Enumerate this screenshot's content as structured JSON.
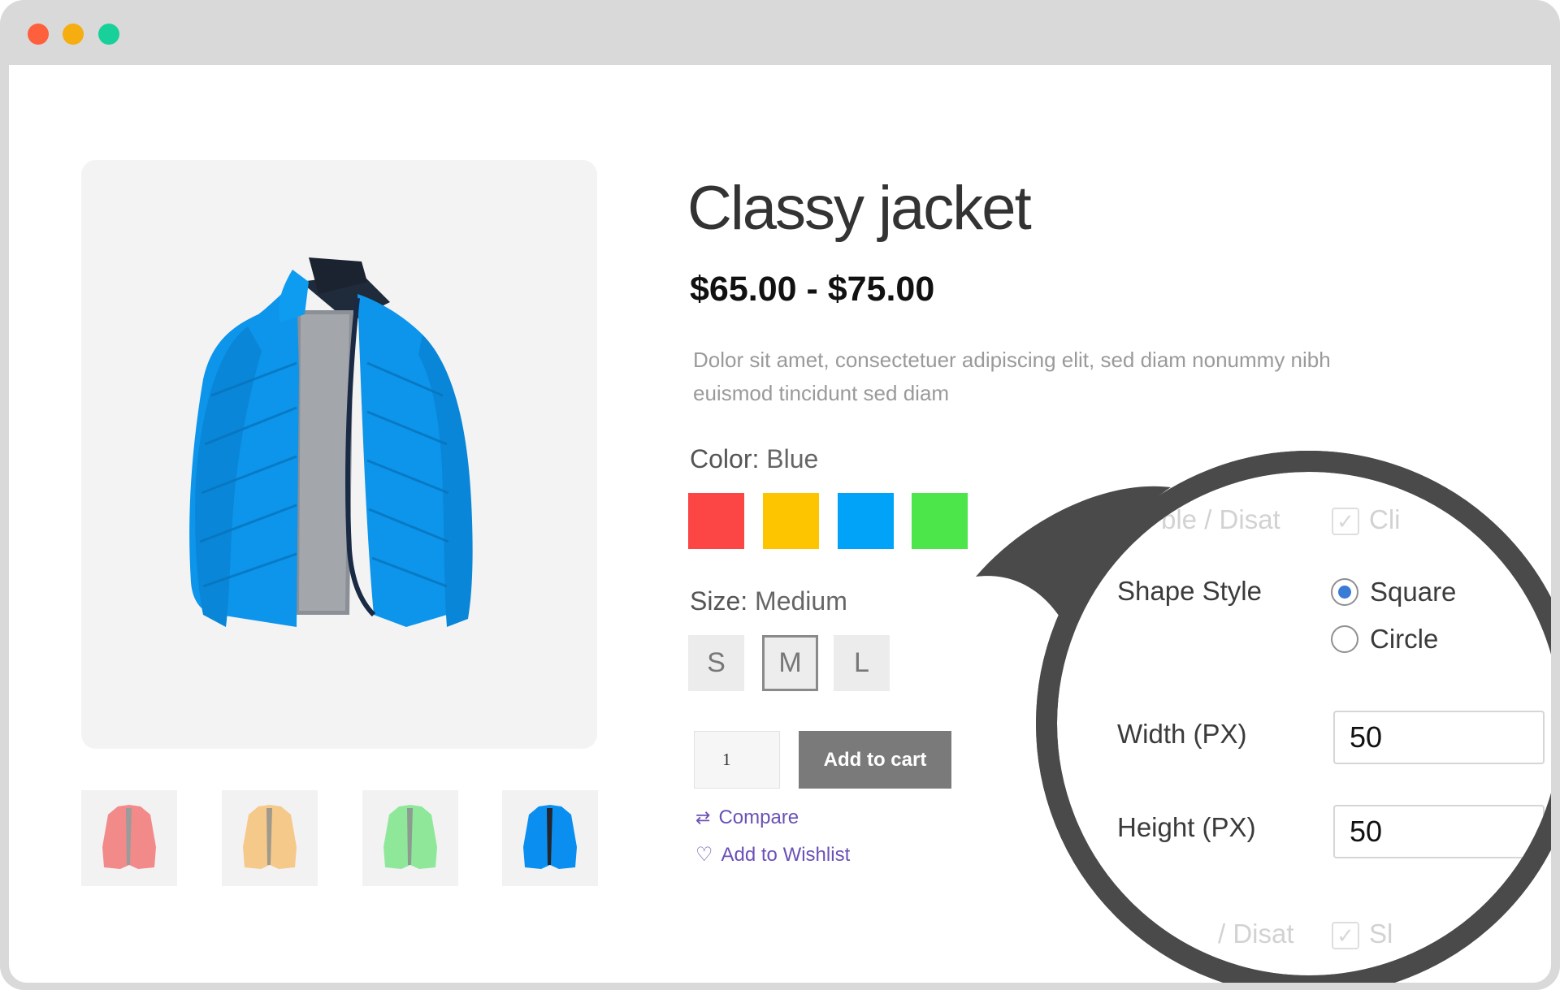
{
  "window": {
    "controls": [
      {
        "name": "close-dot",
        "color": "#fe5f3c"
      },
      {
        "name": "minimize-dot",
        "color": "#f5ad0f"
      },
      {
        "name": "maximize-dot",
        "color": "#18d09a"
      }
    ]
  },
  "product": {
    "title": "Classy jacket",
    "price": "$65.00 - $75.00",
    "description": "Dolor sit amet, consectetuer adipiscing elit, sed diam nonummy nibh euismod tincidunt sed diam",
    "main_image_icon": "blue-jacket-image",
    "thumbnails": [
      {
        "icon": "pink-jacket-thumbnail",
        "color": "#f28a8a"
      },
      {
        "icon": "beige-jacket-thumbnail",
        "color": "#f5c98a"
      },
      {
        "icon": "green-jacket-thumbnail",
        "color": "#8fe89a"
      },
      {
        "icon": "blue-jacket-thumbnail",
        "color": "#0a8ff0"
      }
    ]
  },
  "color_attr": {
    "label": "Color:",
    "value": "Blue",
    "swatches": [
      {
        "name": "red",
        "color": "#fc4545"
      },
      {
        "name": "yellow",
        "color": "#fdc500"
      },
      {
        "name": "blue",
        "color": "#00a3f7"
      },
      {
        "name": "green",
        "color": "#4ce64b"
      }
    ]
  },
  "size_attr": {
    "label": "Size:",
    "value": "Medium",
    "options": [
      "S",
      "M",
      "L"
    ],
    "selected": "M"
  },
  "cart": {
    "quantity": "1",
    "add_label": "Add to cart",
    "compare_label": "Compare",
    "wishlist_label": "Add to Wishlist",
    "compare_icon": "compare-arrows-icon",
    "wishlist_icon": "heart-icon"
  },
  "magnifier": {
    "faded_top_label": "ble / Disat",
    "faded_top_check_label": "Cli",
    "shape_style_label": "Shape Style",
    "shape_options": [
      "Square",
      "Circle"
    ],
    "shape_selected": "Square",
    "width_label": "Width (PX)",
    "width_value": "50",
    "height_label": "Height (PX)",
    "height_value": "50",
    "faded_bottom_label": "/ Disat",
    "faded_bottom_check_label": "Sl",
    "ring_color": "#4a4a4a"
  }
}
